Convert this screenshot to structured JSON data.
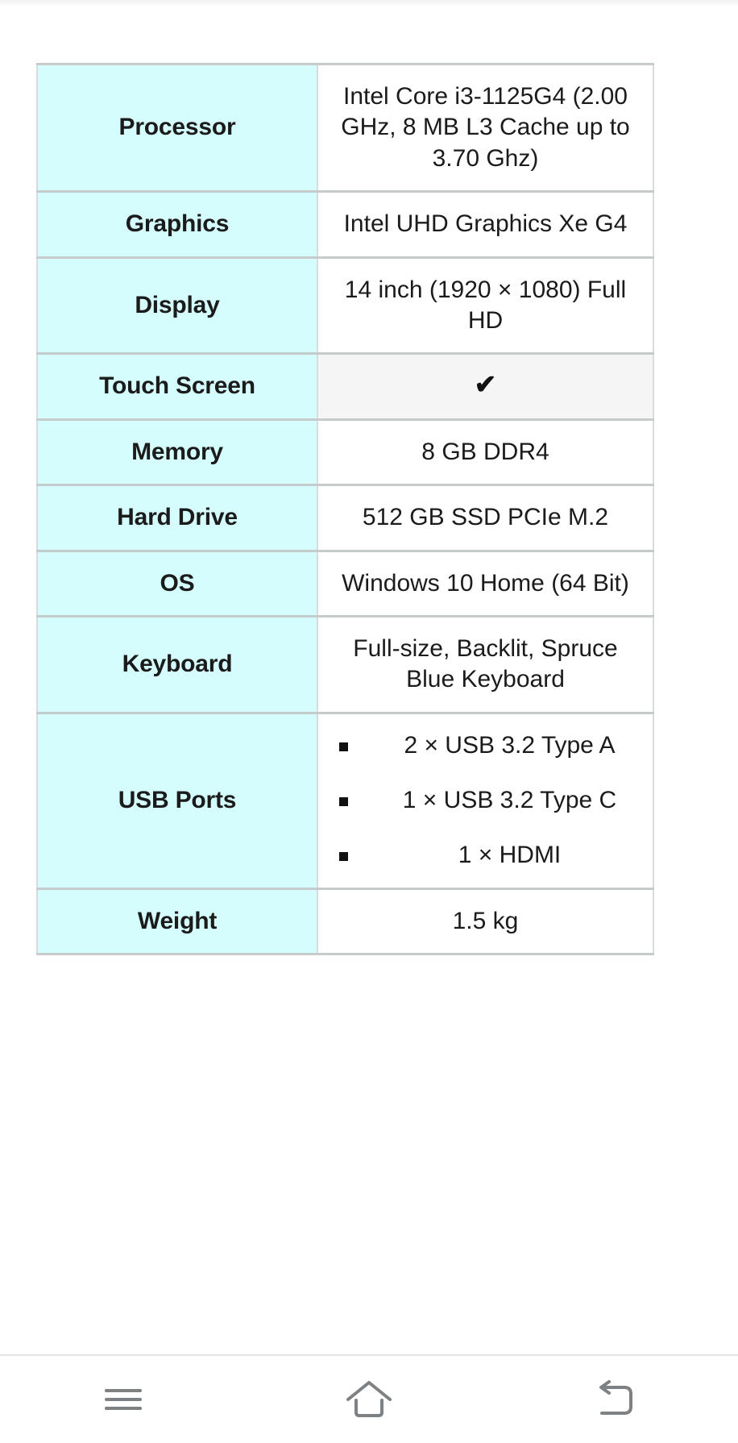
{
  "colors": {
    "label_cell_bg": "#d6fdfd",
    "value_cell_bg": "#ffffff",
    "highlight_value_bg": "#f5f5f5",
    "row_border": "#c6cbcb",
    "text": "#1b1b1b",
    "nav_icon": "#7e8184"
  },
  "spec_table": {
    "rows": [
      {
        "label": "Processor",
        "value": "Intel Core i3-1125G4 (2.00 GHz, 8 MB L3 Cache up to 3.70 Ghz)",
        "type": "text",
        "highlight": false
      },
      {
        "label": "Graphics",
        "value": "Intel UHD Graphics Xe G4",
        "type": "text",
        "highlight": false
      },
      {
        "label": "Display",
        "value": "14 inch (1920 × 1080) Full HD",
        "type": "text",
        "highlight": false
      },
      {
        "label": "Touch Screen",
        "value": "✔",
        "type": "check",
        "highlight": true
      },
      {
        "label": "Memory",
        "value": "8 GB DDR4",
        "type": "text",
        "highlight": false
      },
      {
        "label": "Hard Drive",
        "value": "512 GB SSD PCIe M.2",
        "type": "text",
        "highlight": false
      },
      {
        "label": "OS",
        "value": "Windows 10 Home (64 Bit)",
        "type": "text",
        "highlight": false
      },
      {
        "label": "Keyboard",
        "value": "Full-size, Backlit, Spruce Blue Keyboard",
        "type": "text",
        "highlight": false
      },
      {
        "label": "USB Ports",
        "type": "list",
        "items": [
          "2 × USB 3.2 Type A",
          "1 × USB 3.2 Type C",
          "1 × HDMI"
        ],
        "highlight": false
      },
      {
        "label": "Weight",
        "value": "1.5 kg",
        "type": "text",
        "highlight": false
      }
    ]
  },
  "nav_bar": {
    "buttons": [
      {
        "name": "recents-button",
        "icon": "menu-icon"
      },
      {
        "name": "home-button",
        "icon": "home-icon"
      },
      {
        "name": "back-button",
        "icon": "back-arrow-icon"
      }
    ]
  }
}
